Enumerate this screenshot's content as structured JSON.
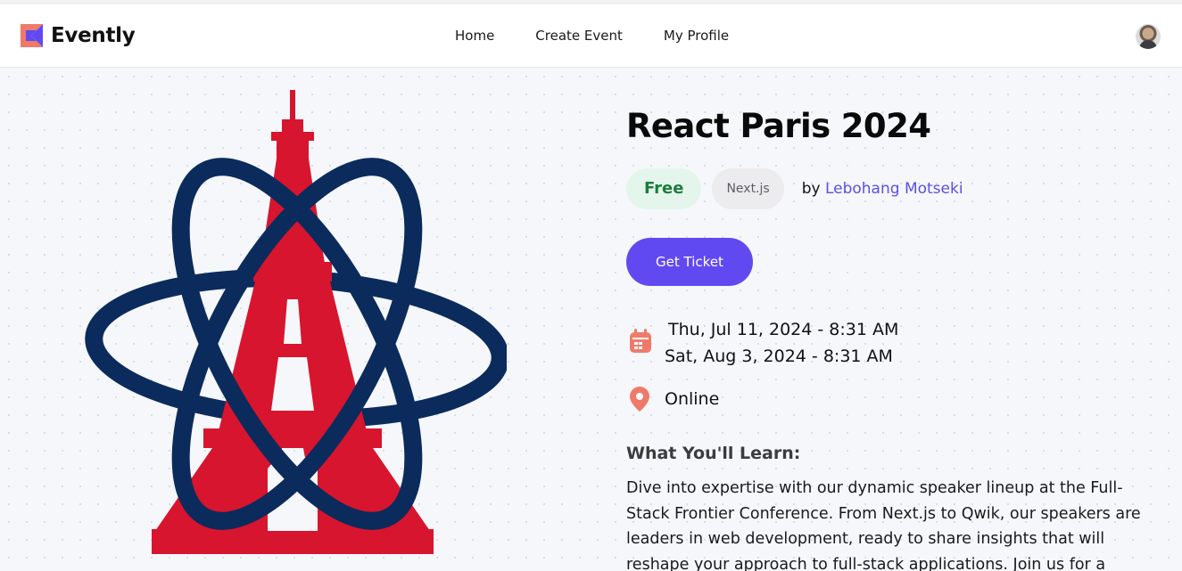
{
  "app": {
    "name": "Evently"
  },
  "nav": {
    "items": [
      {
        "label": "Home"
      },
      {
        "label": "Create Event"
      },
      {
        "label": "My Profile"
      }
    ]
  },
  "event": {
    "title": "React Paris 2024",
    "price_badge": "Free",
    "category": "Next.js",
    "by_prefix": "by",
    "organizer": "Lebohang Motseki",
    "cta_label": "Get Ticket",
    "start": "Thu, Jul 11, 2024 - 8:31 AM",
    "end": "Sat, Aug 3, 2024 - 8:31 AM",
    "location": "Online",
    "learn_heading": "What You'll Learn:",
    "description": "Dive into expertise with our dynamic speaker lineup at the Full-Stack Frontier Conference. From Next.js to Qwik, our speakers are leaders in web development, ready to share insights that will reshape your approach to full-stack applications. Join us for a"
  },
  "icons": {
    "calendar": "calendar-icon",
    "location": "location-pin-icon",
    "logo": "evently-logo-icon",
    "avatar": "user-avatar"
  },
  "colors": {
    "accent": "#6149f2",
    "organizer_link": "#5b4fe0",
    "free_badge_bg": "#e4f6ec",
    "free_badge_text": "#1b7d3d",
    "icon_salmon": "#f07a6a",
    "hero_red": "#d8152e",
    "hero_navy": "#0b2b5c"
  }
}
